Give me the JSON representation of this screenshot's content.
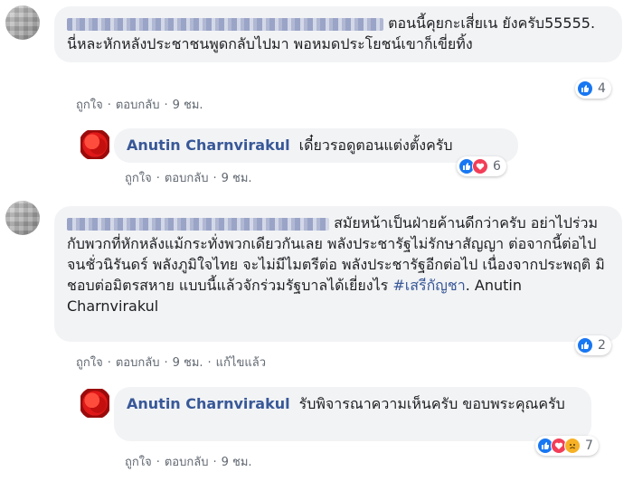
{
  "comments": [
    {
      "text": "ตอนนี้คุยกะเสี่ยเน ยังครับ55555. นี่หละหักหลังประชาชนพูดกลับไปมา พอหมดประโยชน์เขาก็เขี่ยทิ้ง",
      "meta": {
        "like": "ถูกใจ",
        "reply": "ตอบกลับ",
        "time": "9 ชม."
      },
      "reactions": {
        "count": "4"
      },
      "reply": {
        "author": "Anutin Charnvirakul",
        "text": "เดี๋ยวรอดูตอนแต่งตั้งครับ",
        "meta": {
          "like": "ถูกใจ",
          "reply": "ตอบกลับ",
          "time": "9 ชม."
        },
        "reactions": {
          "count": "6"
        }
      }
    },
    {
      "text": "สมัยหน้าเป็นฝ่ายค้านดีกว่าครับ อย่าไปร่วมกับพวกที่หักหลังแม้กระทั่งพวกเดียวกันเลย พลังประชารัฐไม่รักษาสัญญา ต่อจากนี้ต่อไปจนชั่วนิรันดร์ พลังภูมิใจไทย จะไม่มีไมตรีต่อ พลังประชารัฐอีกต่อไป เนื่องจากประพฤติ มิชอบต่อมิตรสหาย แบบนี้แล้วจักร่วมรัฐบาลได้เยี่ยงไร",
      "hashtag": "#เสรีกัญชา",
      "mention": ". Anutin Charnvirakul",
      "meta": {
        "like": "ถูกใจ",
        "reply": "ตอบกลับ",
        "time": "9 ชม.",
        "edited": "แก้ไขแล้ว"
      },
      "reactions": {
        "count": "2"
      },
      "reply": {
        "author": "Anutin Charnvirakul",
        "text": "รับพิจารณาความเห็นครับ ขอบพระคุณครับ",
        "meta": {
          "like": "ถูกใจ",
          "reply": "ตอบกลับ",
          "time": "9 ชม."
        },
        "reactions": {
          "count": "7"
        }
      }
    }
  ],
  "icons": {
    "like": "thumbs-up-icon",
    "love": "heart-icon",
    "sad": "sad-face-icon"
  },
  "colors": {
    "like": "#1877f2",
    "love": "#f33e58",
    "sad": "#f7b125",
    "name": "#385898"
  }
}
